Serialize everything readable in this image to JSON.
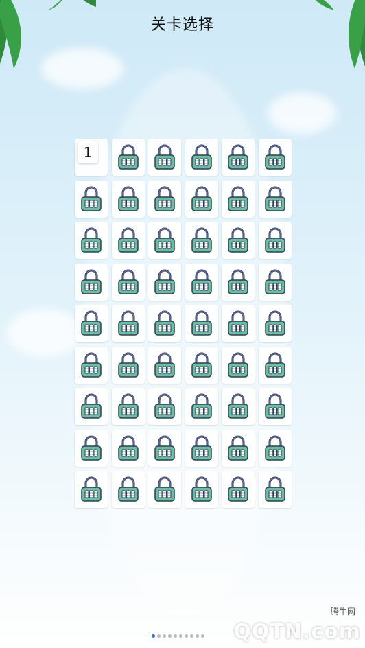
{
  "header": {
    "title": "关卡选择"
  },
  "levels": {
    "unlocked_label": "1",
    "rows": 9,
    "cols": 6
  },
  "pager": {
    "count": 10,
    "active_index": 0
  },
  "watermark": {
    "logo_text": "QQTN.com",
    "site_name": "腾牛网"
  },
  "colors": {
    "lock_body": "#6bbf9d",
    "lock_shackle": "#6a6f9a",
    "lock_outline": "#2e3b5c",
    "dot_active": "#2f6fe4",
    "dot_inactive": "#b9bcc4"
  }
}
